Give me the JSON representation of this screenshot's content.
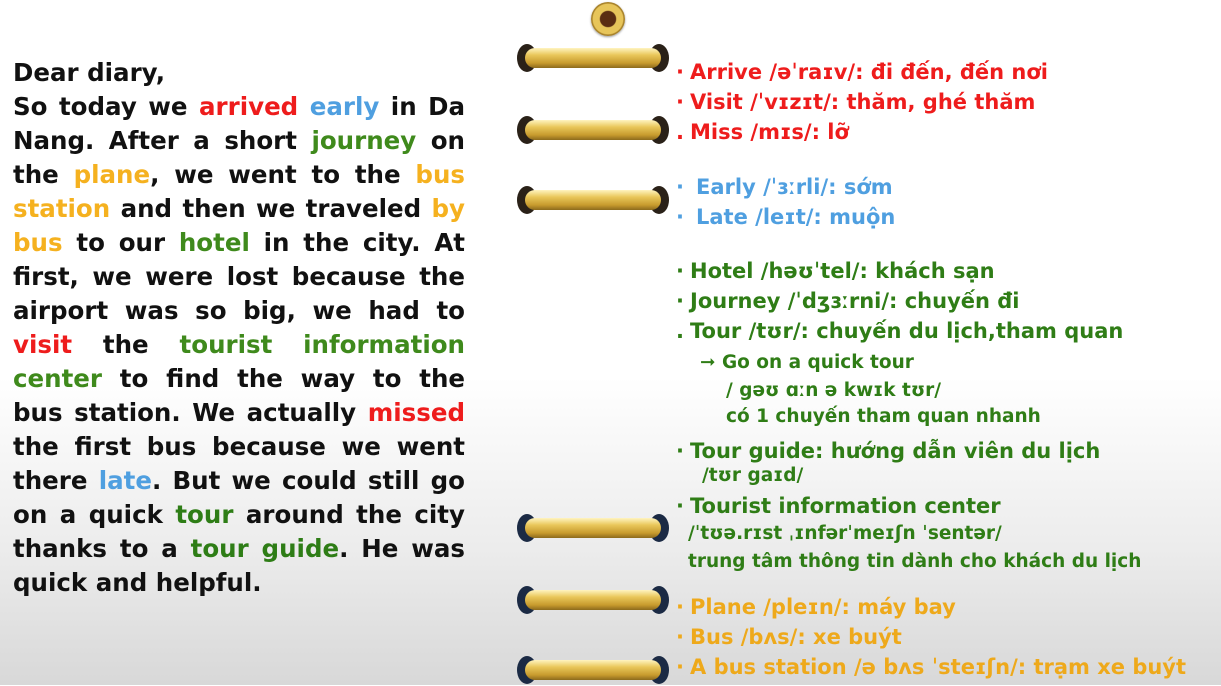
{
  "diary": {
    "greeting": "Dear diary,",
    "segments": [
      {
        "text": "So today we ",
        "color": "default"
      },
      {
        "text": "arrived",
        "color": "red"
      },
      {
        "text": " ",
        "color": "default"
      },
      {
        "text": "early",
        "color": "blue"
      },
      {
        "text": " in Da Nang. After a short ",
        "color": "default"
      },
      {
        "text": "journey",
        "color": "green"
      },
      {
        "text": " on the ",
        "color": "default"
      },
      {
        "text": "plane",
        "color": "gold"
      },
      {
        "text": ", we went to the ",
        "color": "default"
      },
      {
        "text": "bus station",
        "color": "gold"
      },
      {
        "text": " and then we traveled ",
        "color": "default"
      },
      {
        "text": "by bus",
        "color": "gold"
      },
      {
        "text": " to our ",
        "color": "default"
      },
      {
        "text": "hotel",
        "color": "green"
      },
      {
        "text": " in the city. At first, we were lost because the airport was so big, we had to ",
        "color": "default"
      },
      {
        "text": "visit",
        "color": "red"
      },
      {
        "text": " the ",
        "color": "default"
      },
      {
        "text": "tourist information center",
        "color": "green"
      },
      {
        "text": " to find the way to the bus station. We actually ",
        "color": "default"
      },
      {
        "text": "missed",
        "color": "red"
      },
      {
        "text": " the first bus because we went there ",
        "color": "default"
      },
      {
        "text": "late",
        "color": "blue"
      },
      {
        "text": ". But we could still go on a quick ",
        "color": "default"
      },
      {
        "text": "tour",
        "color": "darkgreen"
      },
      {
        "text": " around the city thanks to a ",
        "color": "default"
      },
      {
        "text": "tour guide",
        "color": "darkgreen"
      },
      {
        "text": ". He was quick and helpful.",
        "color": "default"
      }
    ]
  },
  "vocab": {
    "arrive": "Arrive /əˈraɪv/: đi đến, đến nơi",
    "visit": "Visit /ˈvɪzɪt/: thăm, ghé thăm",
    "miss": "Miss /mɪs/: lỡ",
    "early": "Early /ˈɜːrli/: sớm",
    "late": "Late /leɪt/: muộn",
    "hotel": "Hotel /həʊˈtel/: khách sạn",
    "journey": "Journey /ˈdʒɜːrni/: chuyến đi",
    "tour": "Tour /tʊr/: chuyến du lịch,tham quan",
    "tour_sub_1": "Go on a quick tour",
    "tour_sub_2": "/ gəʊ ɑːn ə kwɪk tʊr/",
    "tour_sub_3": "có 1 chuyến tham quan nhanh",
    "tour_guide": "Tour guide: hướng dẫn viên du lịch",
    "tour_guide_ipa": "/tʊr gaɪd/",
    "tic": "Tourist information center",
    "tic_ipa": "/ˈtʊə.rɪst ˌɪnfərˈmeɪʃn ˈsentər/",
    "tic_meaning": "trung tâm thông tin dành cho khách du lịch",
    "plane": "Plane /pleɪn/: máy bay",
    "bus": "Bus /bʌs/: xe buýt",
    "bus_station": "A bus station /ə bʌs ˈsteɪʃn/: trạm xe buýt",
    "bullet_dot": "·",
    "bullet_period": ".",
    "arrow": "➞"
  },
  "colors": {
    "red": "#ee1c1c",
    "blue": "#4f9fe0",
    "green": "#3f8a1c",
    "gold": "#f5b11f",
    "darkgreen": "#2e7d16"
  }
}
